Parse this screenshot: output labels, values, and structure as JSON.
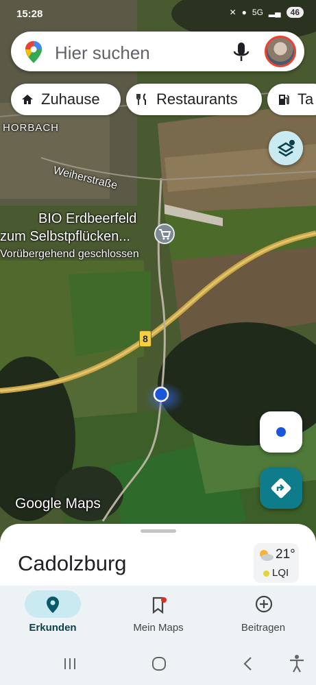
{
  "status_bar": {
    "time": "15:28",
    "network": "5G",
    "battery": "46"
  },
  "search": {
    "placeholder": "Hier suchen"
  },
  "chips": [
    {
      "label": "Zuhause",
      "icon": "home-icon"
    },
    {
      "label": "Restaurants",
      "icon": "restaurant-icon"
    },
    {
      "label": "Ta",
      "icon": "gas-station-icon"
    }
  ],
  "map": {
    "labels": {
      "village": "HORBACH",
      "street": "Weiherstraße",
      "poi_name_line1": "BIO Erdbeerfeld",
      "poi_name_line2": "zum Selbstpflücken...",
      "poi_status": "Vorübergehend geschlossen",
      "road_number": "8"
    },
    "watermark": "Google Maps"
  },
  "sheet": {
    "place_name": "Cadolzburg",
    "weather": {
      "temperature": "21°",
      "air_quality": "LQI"
    }
  },
  "bottom_nav": [
    {
      "label": "Erkunden",
      "icon": "explore-pin-icon",
      "active": true
    },
    {
      "label": "Mein Maps",
      "icon": "bookmark-icon",
      "active": false
    },
    {
      "label": "Beitragen",
      "icon": "add-circle-icon",
      "active": false
    }
  ],
  "colors": {
    "accent": "#0b5868",
    "location_blue": "#1a56db",
    "directions_teal": "#0f7c8c"
  }
}
